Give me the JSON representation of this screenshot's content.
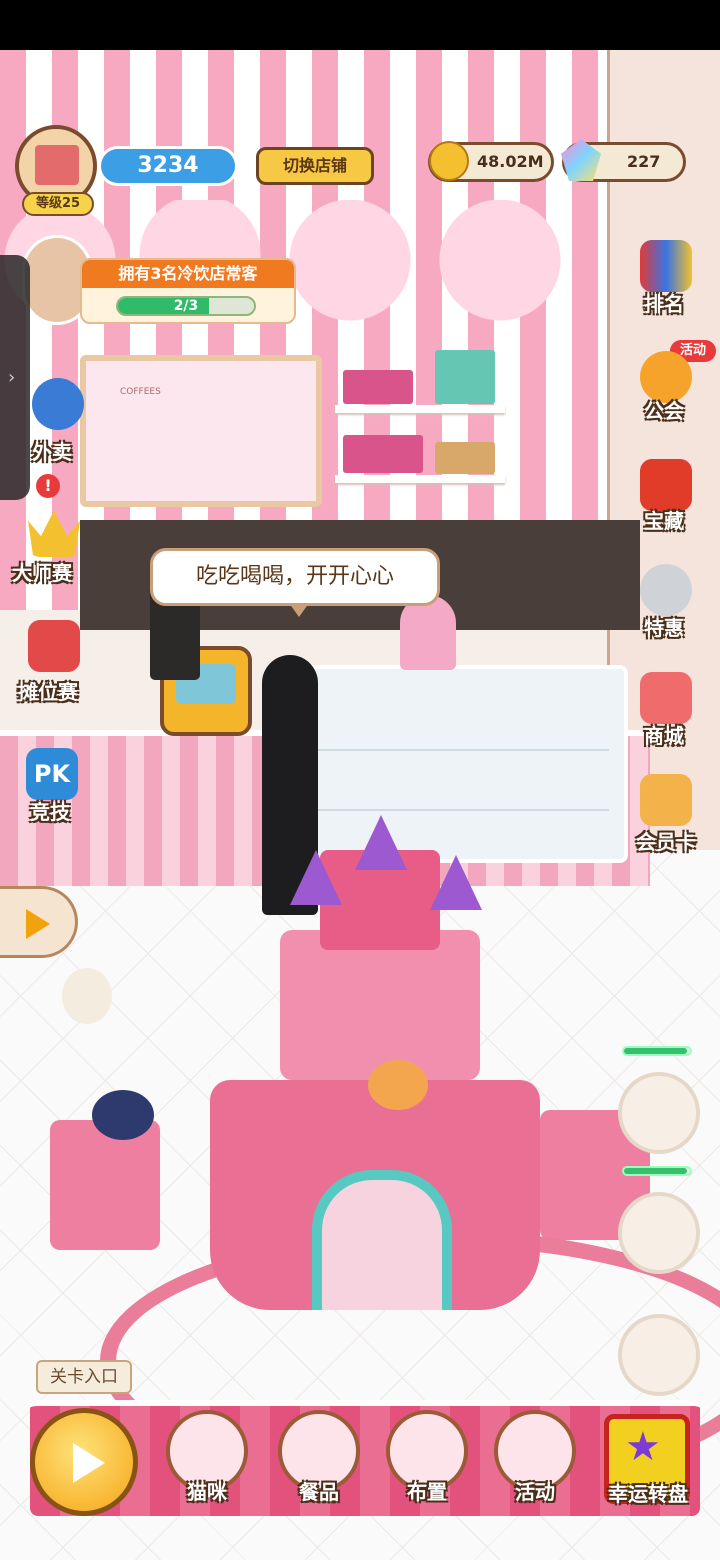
{
  "hud": {
    "level_label": "等级25",
    "score_value": "3234",
    "switch_store_label": "切换店铺",
    "coins_value": "48.02M",
    "gems_value": "227"
  },
  "quest": {
    "title": "拥有3名冷饮店常客",
    "progress_text": "2/3",
    "progress_fraction": 0.667
  },
  "speech_bubble": "吃吃喝喝，开开心心",
  "menu_board_title": "COFFEES",
  "left_menu": [
    {
      "id": "takeout",
      "label": "外卖",
      "icon": "scooter-rider-icon"
    },
    {
      "id": "master",
      "label": "大师赛",
      "icon": "crown-icon",
      "alert": "!"
    },
    {
      "id": "stall",
      "label": "摊位赛",
      "icon": "stall-icon"
    },
    {
      "id": "pk",
      "label": "竞技",
      "icon": "pk-icon"
    }
  ],
  "right_menu": [
    {
      "id": "rank",
      "label": "排名",
      "icon": "rank-cards-icon"
    },
    {
      "id": "guild",
      "label": "公会",
      "icon": "paw-badge-icon",
      "badge": "活动"
    },
    {
      "id": "treasure",
      "label": "宝藏",
      "icon": "gift-box-icon"
    },
    {
      "id": "deal",
      "label": "特惠",
      "icon": "cat-face-icon"
    },
    {
      "id": "mall",
      "label": "商城",
      "icon": "shop-icon"
    },
    {
      "id": "vip",
      "label": "会员卡",
      "icon": "vip-card-icon"
    }
  ],
  "guests": [
    {
      "id": "guest1",
      "progress": 0.95
    },
    {
      "id": "guest2",
      "progress": 0.95
    },
    {
      "id": "guest3",
      "progress": 0
    }
  ],
  "bottom": {
    "stage_entry_label": "关卡入口",
    "buttons": [
      {
        "id": "cats",
        "label": "猫咪",
        "icon": "paw-icon"
      },
      {
        "id": "food",
        "label": "餐品",
        "icon": "donut-icon"
      },
      {
        "id": "decor",
        "label": "布置",
        "icon": "pencil-ruler-icon"
      },
      {
        "id": "event",
        "label": "活动",
        "icon": "pinwheel-icon"
      }
    ],
    "wheel_label": "幸运转盘"
  },
  "colors": {
    "accent_pink": "#e2527d",
    "score_blue": "#3c9fe6",
    "quest_orange": "#f07a1f",
    "progress_green": "#2fbb6a",
    "button_gold": "#f7c843"
  }
}
